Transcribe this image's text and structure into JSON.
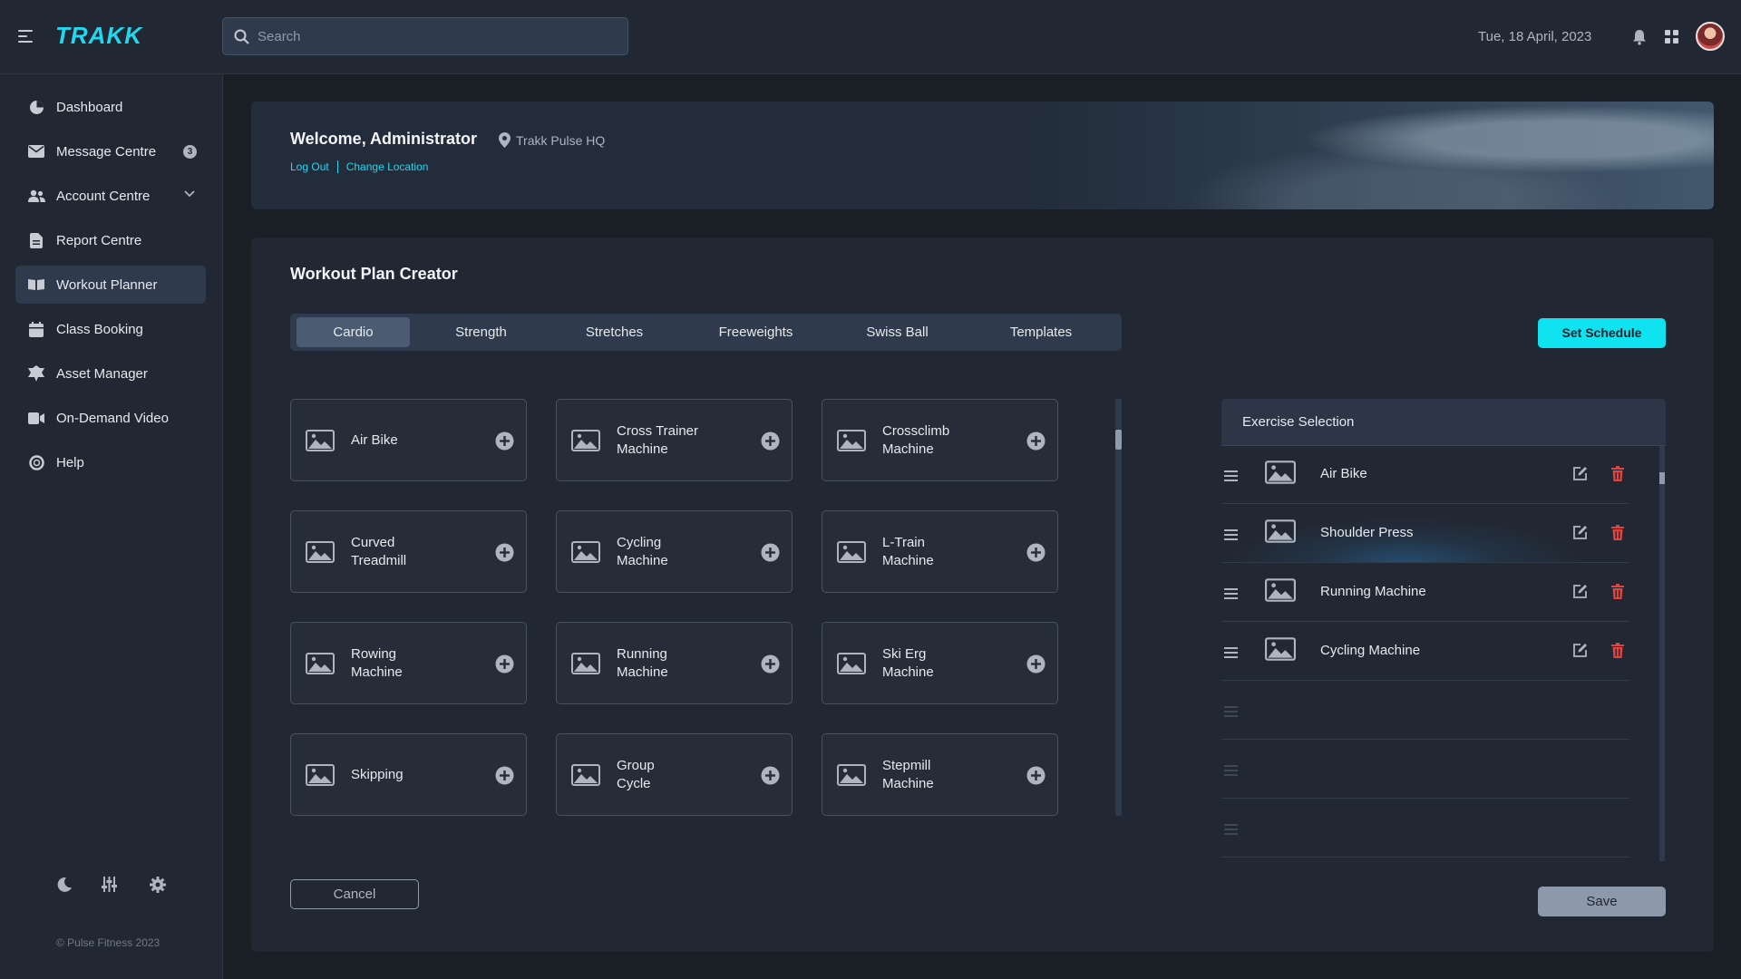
{
  "app": {
    "logo": "TRAKK"
  },
  "topbar": {
    "search_placeholder": "Search",
    "date": "Tue, 18 April, 2023"
  },
  "sidebar": {
    "items": [
      {
        "label": "Dashboard",
        "icon": "dashboard-icon"
      },
      {
        "label": "Message Centre",
        "icon": "mail-icon",
        "badge": "3"
      },
      {
        "label": "Account Centre",
        "icon": "users-icon"
      },
      {
        "label": "Report Centre",
        "icon": "report-icon"
      },
      {
        "label": "Workout Planner",
        "icon": "book-icon",
        "active": true
      },
      {
        "label": "Class Booking",
        "icon": "calendar-icon"
      },
      {
        "label": "Asset Manager",
        "icon": "asset-icon"
      },
      {
        "label": "On-Demand Video",
        "icon": "video-icon"
      },
      {
        "label": "Help",
        "icon": "help-icon"
      }
    ],
    "copyright": "© Pulse Fitness 2023"
  },
  "banner": {
    "welcome": "Welcome, Administrator",
    "location": "Trakk Pulse HQ",
    "logout": "Log Out",
    "change_location": "Change Location"
  },
  "planner": {
    "title": "Workout Plan Creator",
    "tabs": [
      "Cardio",
      "Strength",
      "Stretches",
      "Freeweights",
      "Swiss Ball",
      "Templates"
    ],
    "active_tab": "Cardio",
    "set_schedule": "Set Schedule",
    "cards": [
      {
        "l1": "Air Bike",
        "l2": ""
      },
      {
        "l1": "Cross Trainer",
        "l2": "Machine"
      },
      {
        "l1": "Crossclimb",
        "l2": "Machine"
      },
      {
        "l1": "Curved",
        "l2": "Treadmill"
      },
      {
        "l1": "Cycling",
        "l2": "Machine"
      },
      {
        "l1": "L-Train",
        "l2": "Machine"
      },
      {
        "l1": "Rowing",
        "l2": "Machine"
      },
      {
        "l1": "Running",
        "l2": "Machine"
      },
      {
        "l1": "Ski Erg",
        "l2": "Machine"
      },
      {
        "l1": "Skipping",
        "l2": ""
      },
      {
        "l1": "Group",
        "l2": "Cycle"
      },
      {
        "l1": "Stepmill",
        "l2": "Machine"
      }
    ],
    "cancel": "Cancel",
    "save": "Save"
  },
  "selection": {
    "title": "Exercise Selection",
    "rows": [
      "Air Bike",
      "Shoulder Press",
      "Running Machine",
      "Cycling Machine",
      "",
      "",
      ""
    ]
  },
  "colors": {
    "accent": "#0fe3ef",
    "delete": "#e0443e",
    "panel": "#222833"
  }
}
